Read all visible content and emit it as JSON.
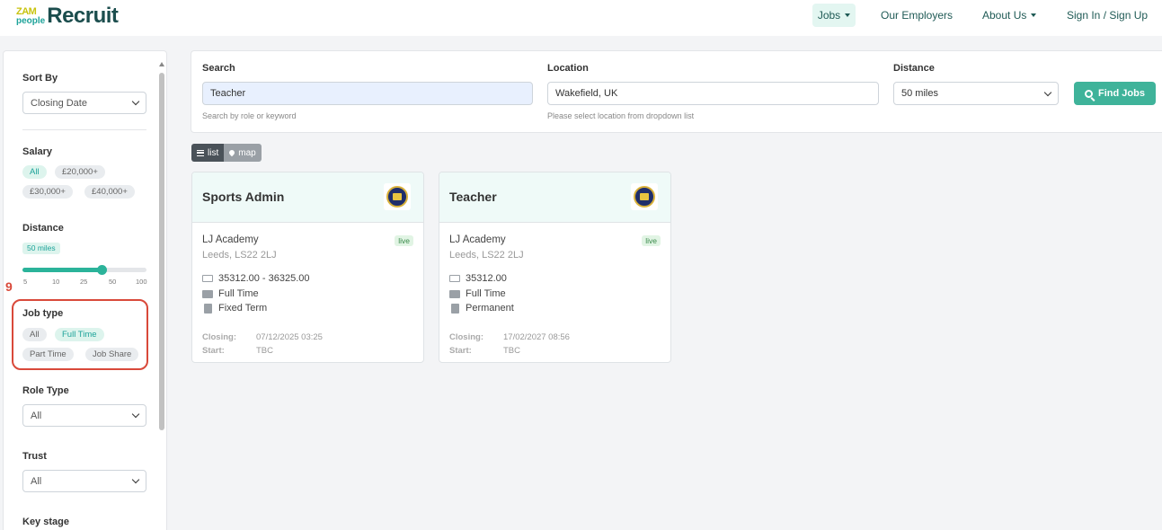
{
  "logo": {
    "mark_top": "ZAM",
    "mark_bottom": "people",
    "text": "Recruit"
  },
  "nav": {
    "jobs": "Jobs",
    "employers": "Our Employers",
    "about": "About Us",
    "signin": "Sign In / Sign Up"
  },
  "sidebar": {
    "sort_label": "Sort By",
    "sort_value": "Closing Date",
    "salary_label": "Salary",
    "salary_options": [
      "All",
      "£20,000+",
      "£30,000+",
      "£40,000+"
    ],
    "distance_label": "Distance",
    "distance_badge": "50 miles",
    "distance_value": 50,
    "distance_ticks": [
      "5",
      "10",
      "25",
      "50",
      "100"
    ],
    "highlight_number": "9",
    "jobtype_label": "Job type",
    "jobtype_options": [
      "All",
      "Full Time",
      "Part Time",
      "Job Share"
    ],
    "roletype_label": "Role Type",
    "roletype_value": "All",
    "trust_label": "Trust",
    "trust_value": "All",
    "keystage_label": "Key stage"
  },
  "search": {
    "search_label": "Search",
    "search_value": "Teacher",
    "search_help": "Search by role or keyword",
    "location_label": "Location",
    "location_value": "Wakefield, UK",
    "location_help": "Please select location from dropdown list",
    "distance_label": "Distance",
    "distance_value": "50 miles",
    "find_button": "Find Jobs"
  },
  "view_toggle": {
    "list": "list",
    "map": "map"
  },
  "jobs": [
    {
      "title": "Sports Admin",
      "employer": "LJ Academy",
      "location": "Leeds, LS22 2LJ",
      "status": "live",
      "salary": "35312.00 - 36325.00",
      "hours": "Full Time",
      "contract": "Fixed Term",
      "closing_label": "Closing:",
      "closing": "07/12/2025 03:25",
      "start_label": "Start:",
      "start": "TBC"
    },
    {
      "title": "Teacher",
      "employer": "LJ Academy",
      "location": "Leeds, LS22 2LJ",
      "status": "live",
      "salary": "35312.00",
      "hours": "Full Time",
      "contract": "Permanent",
      "closing_label": "Closing:",
      "closing": "17/02/2027 08:56",
      "start_label": "Start:",
      "start": "TBC"
    }
  ],
  "colors": {
    "accent": "#3fb39a",
    "brand_dark": "#1b4d4d",
    "highlight": "#d9493a"
  }
}
